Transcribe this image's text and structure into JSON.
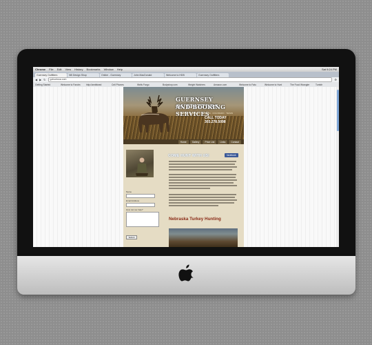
{
  "colors": {
    "nav_bg": "#4a3b24",
    "heading": "#ffffff",
    "subheading": "#8a2a16",
    "facebook": "#3b5998",
    "page_bg": "#ddd4b9"
  },
  "browser": {
    "menu": [
      "Chrome",
      "File",
      "Edit",
      "View",
      "History",
      "Bookmarks",
      "Window",
      "Help"
    ],
    "clock": "Sat 9:24 PM",
    "tabs": [
      "Guernsey Outfitters",
      "NB Design Shop",
      "Online - Guernsey",
      "John MacDonald",
      "Welcome to HDB",
      "Guernsey Outfitters"
    ],
    "url": "gohuntusa.com",
    "bookmarks": [
      "Getting Started",
      "Welcome to Fandm",
      "http://ambitwed",
      "Cell Phones",
      "Wells Fargo",
      "Bodystory.com",
      "Weight Watchers",
      "Amazon.com",
      "Welcome to Fatu",
      "Welcome to Hunt",
      "The Food Wrangler",
      "Tumblr"
    ]
  },
  "site": {
    "brand_line1": "GUERNSEY OUTFITTERS",
    "brand_line2": "AND BOOKING SERVICES",
    "brand_sub": "WYOMING · NEBRASKA · KANSAS · COLORADO · TEXAS",
    "phone": "CALL TODAY 303.278.5098",
    "nav": [
      "Home",
      "Gallery",
      "Price List",
      "Links",
      "Contact"
    ],
    "heading": "COME HUNT WITH US!",
    "facebook_label": "facebook",
    "subheading": "Nebraska Turkey Hunting",
    "form": {
      "name_label": "Name",
      "email_label": "Email Address",
      "help_label": "How can we help?",
      "submit_label": "Submit"
    }
  }
}
